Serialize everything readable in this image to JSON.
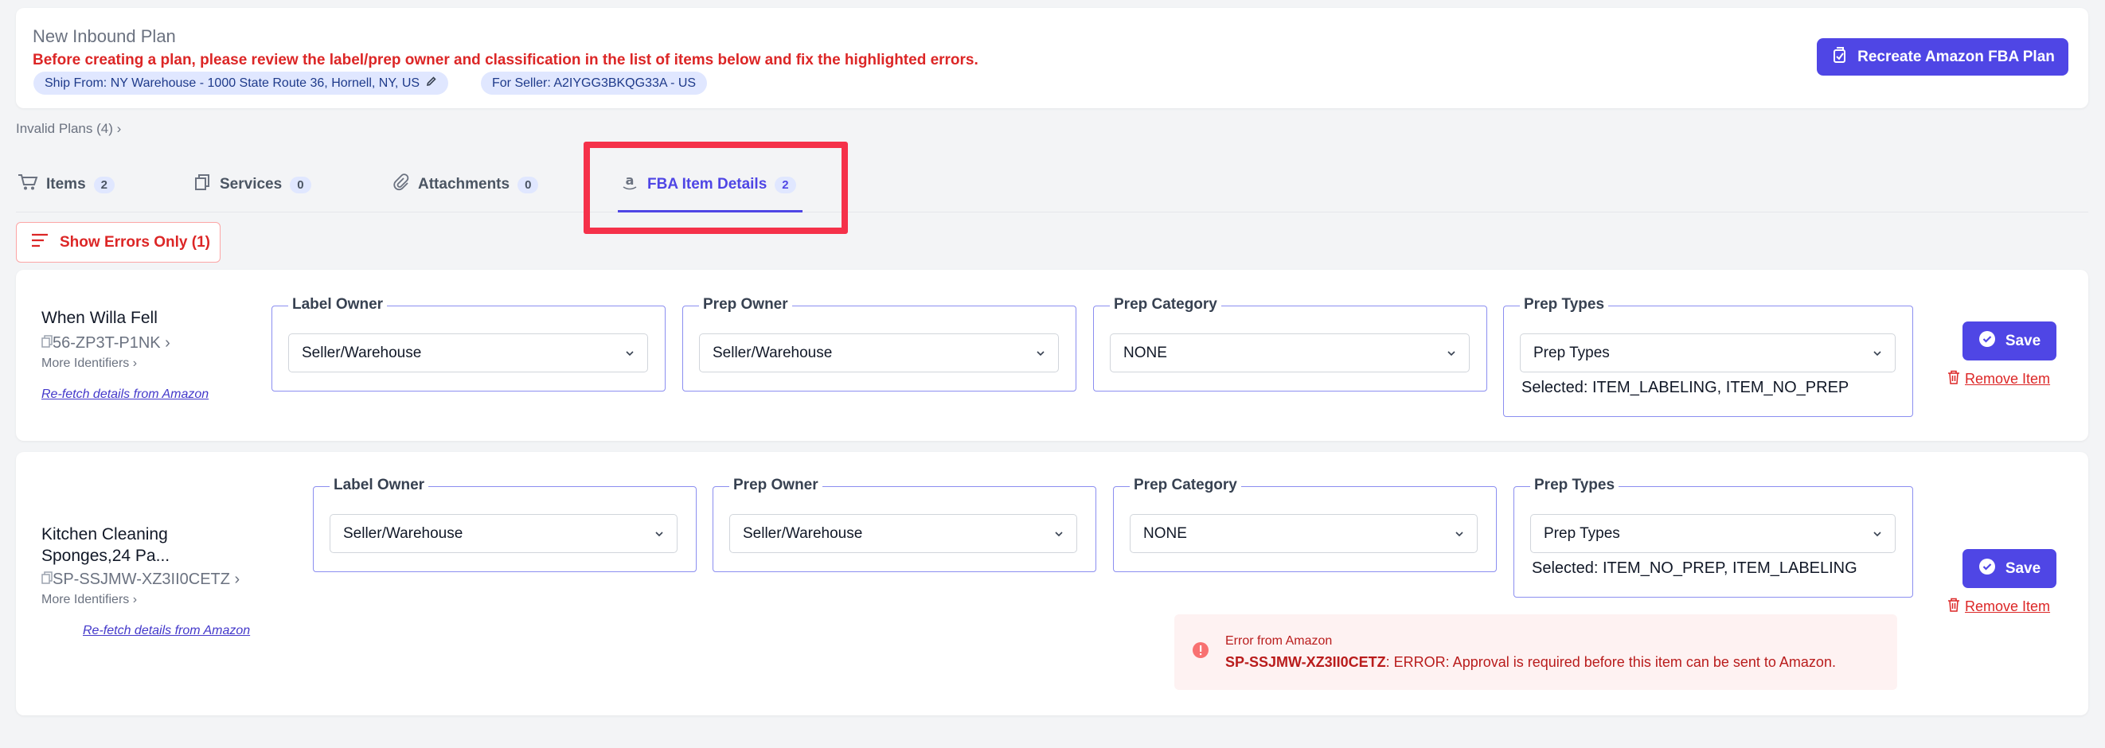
{
  "header": {
    "title": "New Inbound Plan",
    "warning": "Before creating a plan, please review the label/prep owner and classification in the list of items below and fix the highlighted errors.",
    "ship_from": "Ship From: NY Warehouse - 1000 State Route 36, Hornell, NY, US",
    "seller": "For Seller: A2IYGG3BKQG33A - US",
    "recreate_label": "Recreate Amazon FBA Plan"
  },
  "invalid_plans": "Invalid Plans (4)",
  "tabs": [
    {
      "label": "Items",
      "count": "2",
      "icon": "cart-icon"
    },
    {
      "label": "Services",
      "count": "0",
      "icon": "services-icon"
    },
    {
      "label": "Attachments",
      "count": "0",
      "icon": "paperclip-icon"
    },
    {
      "label": "FBA Item Details",
      "count": "2",
      "icon": "amazon-icon",
      "active": true
    }
  ],
  "filter": {
    "show_errors_label": "Show Errors Only (1)"
  },
  "field_labels": {
    "label_owner": "Label Owner",
    "prep_owner": "Prep Owner",
    "prep_category": "Prep Category",
    "prep_types": "Prep Types"
  },
  "items": [
    {
      "name_line1": "When Willa Fell",
      "name_line2": "",
      "sku": "56-ZP3T-P1NK",
      "more_identifiers": "More Identifiers",
      "refetch": "Re-fetch details from Amazon",
      "label_owner": "Seller/Warehouse",
      "prep_owner": "Seller/Warehouse",
      "prep_category": "NONE",
      "prep_types_placeholder": "Prep Types",
      "prep_types_selected": "Selected: ITEM_LABELING, ITEM_NO_PREP",
      "save": "Save",
      "remove": "Remove Item"
    },
    {
      "name_line1": "Kitchen Cleaning",
      "name_line2": "Sponges,24 Pa...",
      "sku": "SP-SSJMW-XZ3II0CETZ",
      "more_identifiers": "More Identifiers",
      "refetch": "Re-fetch details from Amazon",
      "label_owner": "Seller/Warehouse",
      "prep_owner": "Seller/Warehouse",
      "prep_category": "NONE",
      "prep_types_placeholder": "Prep Types",
      "prep_types_selected": "Selected: ITEM_NO_PREP, ITEM_LABELING",
      "save": "Save",
      "remove": "Remove Item",
      "error": {
        "title": "Error from Amazon",
        "sku": "SP-SSJMW-XZ3II0CETZ",
        "message": ": ERROR: Approval is required before this item can be sent to Amazon."
      }
    }
  ],
  "colors": {
    "accent": "#4f46e5",
    "error": "#dc2626",
    "highlight": "#f5314a"
  }
}
